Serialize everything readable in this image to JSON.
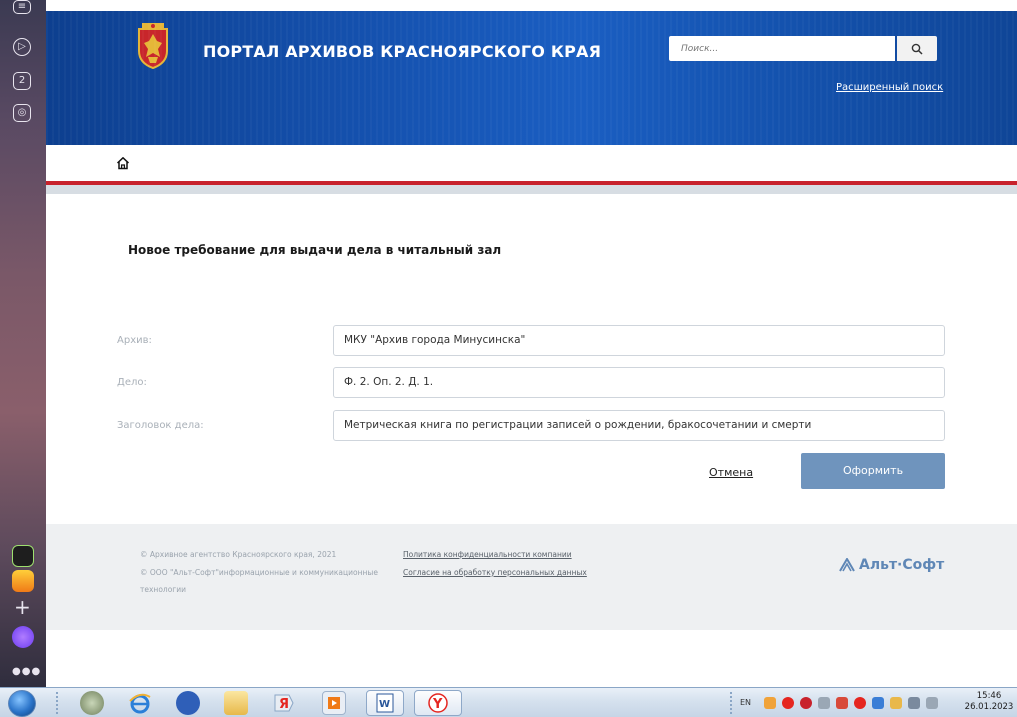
{
  "header": {
    "title": "ПОРТАЛ АРХИВОВ КРАСНОЯРСКОГО КРАЯ",
    "search_placeholder": "Поиск...",
    "advanced_search": "Расширенный поиск"
  },
  "form": {
    "title": "Новое требование для выдачи дела в читальный зал",
    "fields": [
      {
        "label": "Архив:",
        "value": "МКУ \"Архив города Минусинска\""
      },
      {
        "label": "Дело:",
        "value": "Ф. 2. Оп. 2. Д. 1."
      },
      {
        "label": "Заголовок дела:",
        "value": "Метрическая книга по регистрации записей о рождении, бракосочетании и смерти"
      }
    ],
    "cancel_label": "Отмена",
    "submit_label": "Оформить"
  },
  "footer": {
    "copyright_agency": "© Архивное агентство Красноярского края, 2021",
    "copyright_altsoft_line1": "© ООО \"Альт-Софт\"информационные и коммуникационные",
    "copyright_altsoft_line2": "технологии",
    "privacy_link": "Политика конфиденциальности компании",
    "consent_link": "Согласие на обработку персональных данных",
    "brand": "Альт·Софт"
  },
  "rail": {
    "badge_number": "2"
  },
  "taskbar": {
    "language": "EN",
    "time": "15:46",
    "date": "26.01.2023"
  },
  "colors": {
    "header_blue": "#1552b0",
    "accent_red": "#c8222c",
    "submit_blue": "#6f94bd",
    "brand_blue": "#5f87b6"
  }
}
